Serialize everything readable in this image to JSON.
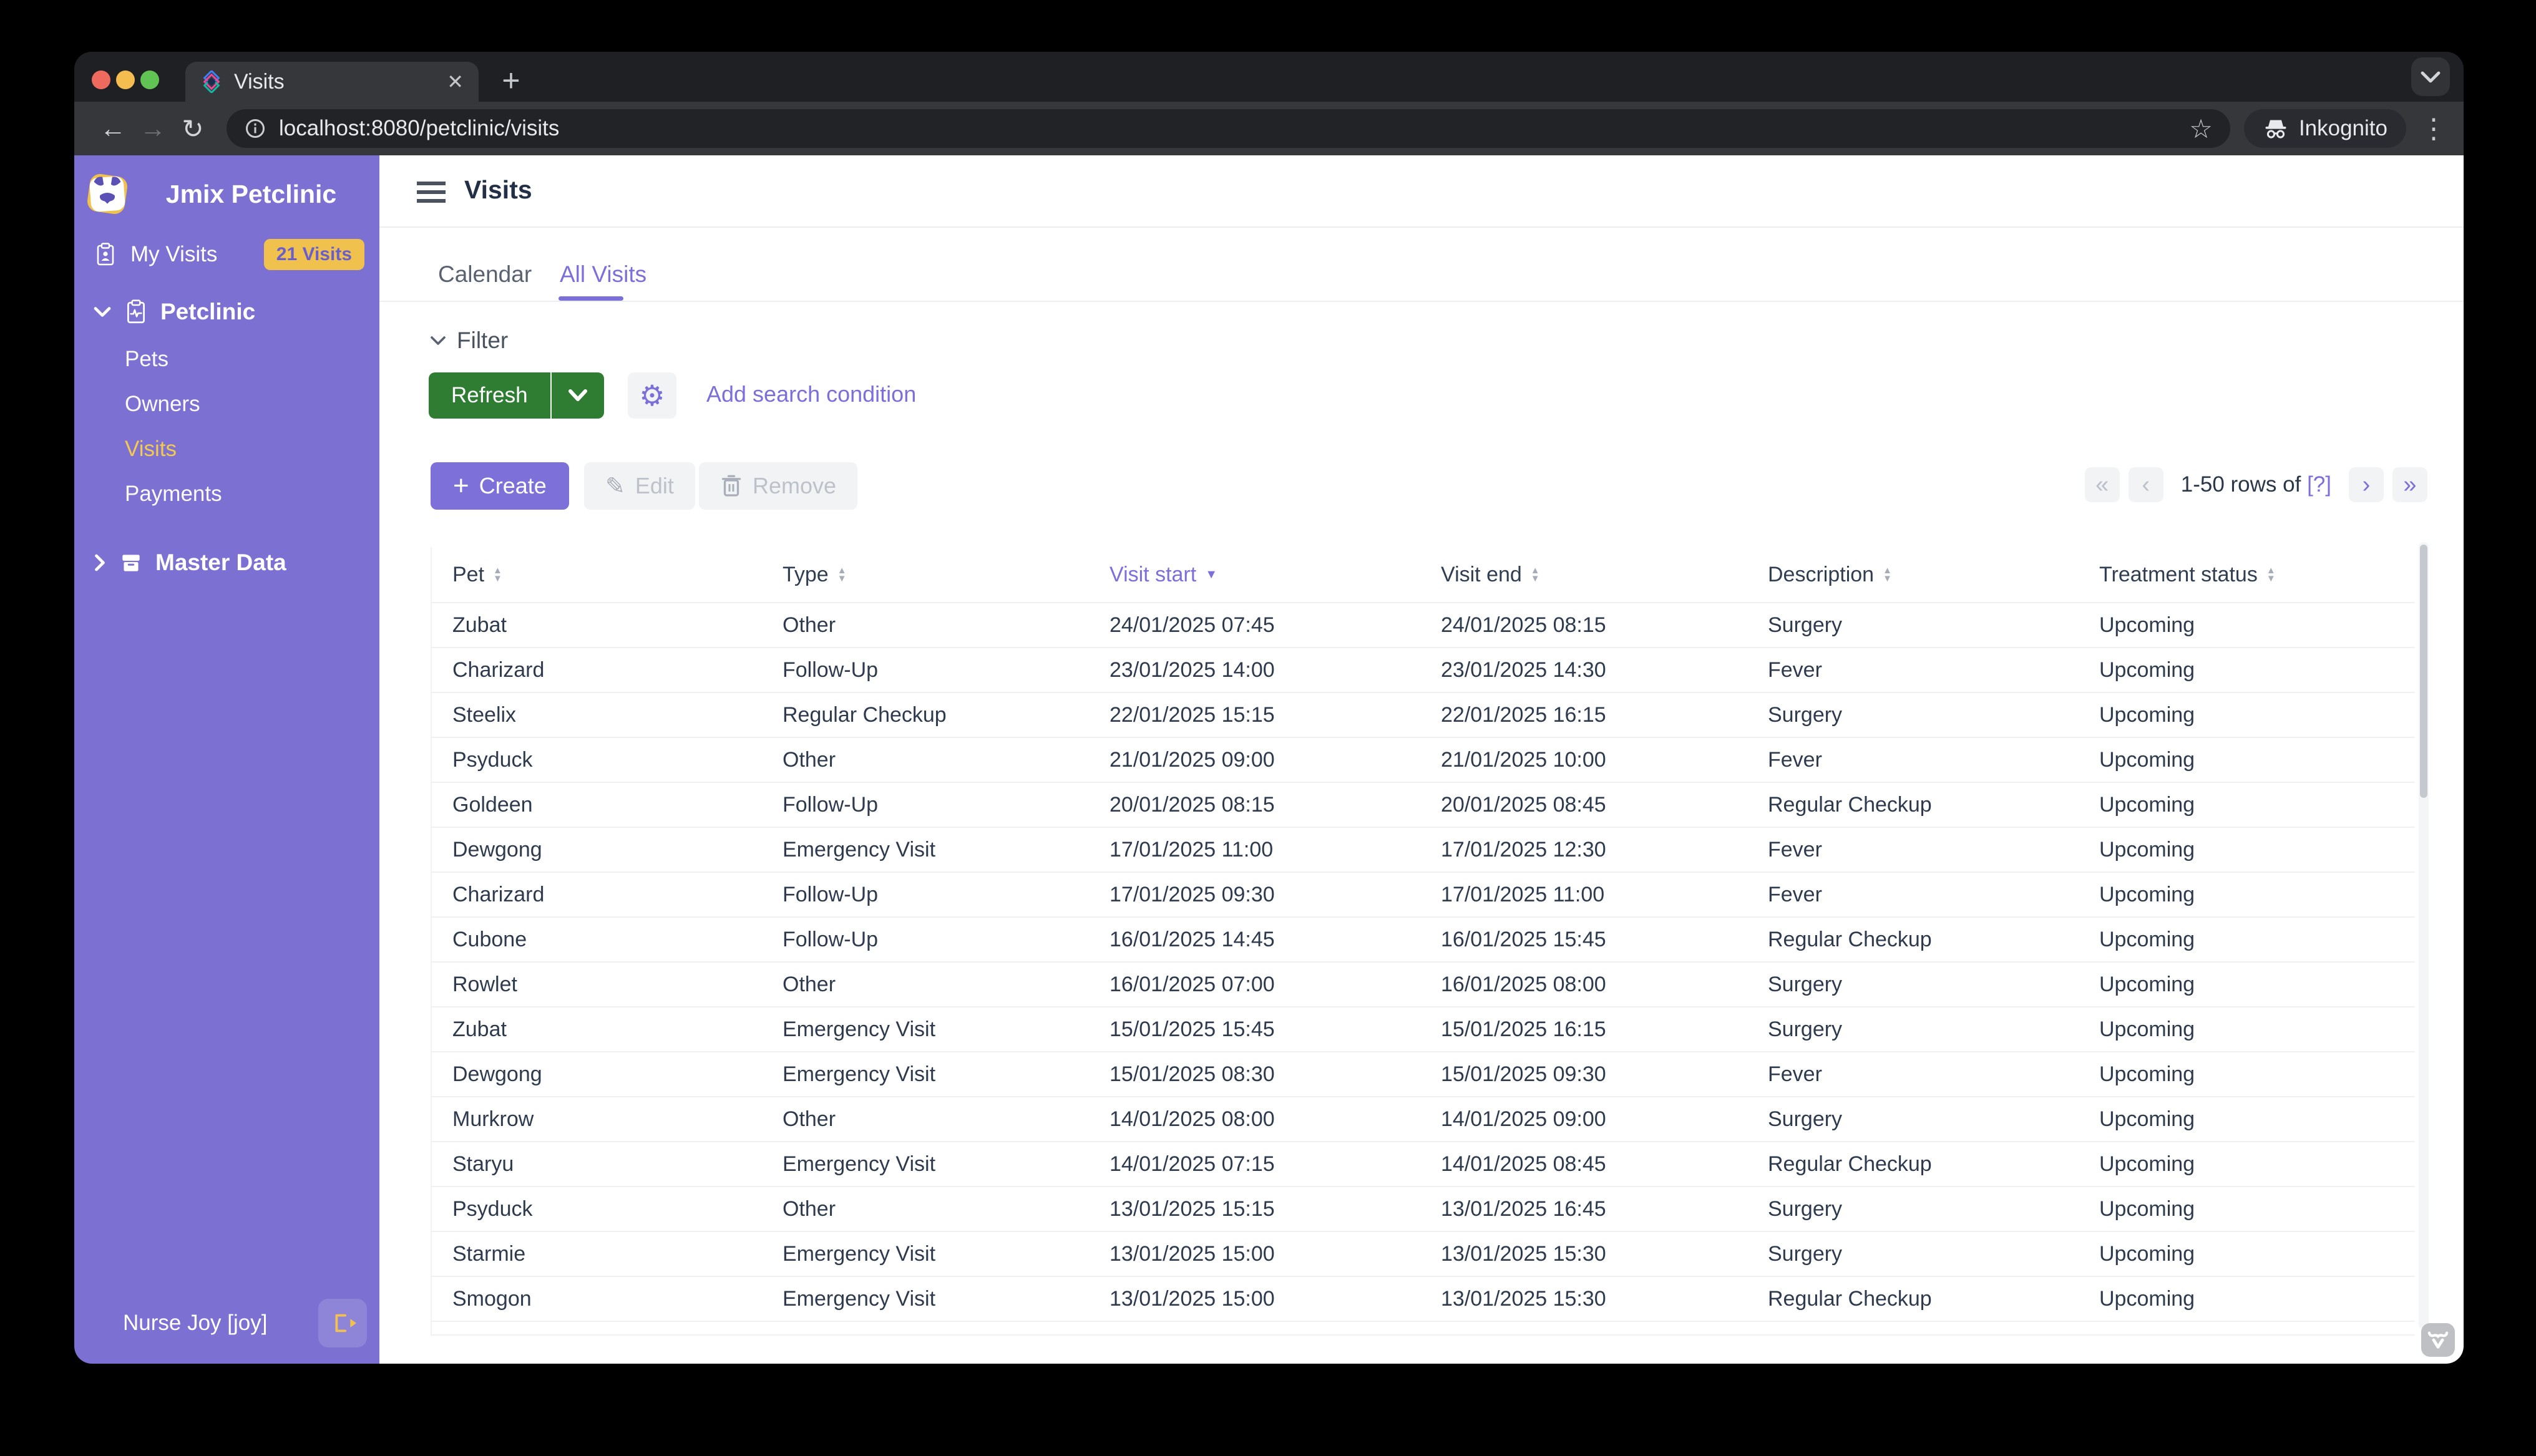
{
  "browser": {
    "tab_title": "Visits",
    "url": "localhost:8080/petclinic/visits",
    "incognito_label": "Inkognito",
    "glyphs": {
      "back": "←",
      "forward": "→",
      "reload": "↻",
      "star": "☆",
      "menu_dots": "⋮",
      "new_tab": "+",
      "tab_close": "✕"
    }
  },
  "sidebar": {
    "app_title": "Jmix Petclinic",
    "my_visits": {
      "label": "My Visits",
      "badge": "21 Visits"
    },
    "groups": [
      {
        "label": "Petclinic",
        "items": [
          "Pets",
          "Owners",
          "Visits",
          "Payments"
        ],
        "active_item": "Visits"
      },
      {
        "label": "Master Data",
        "items": []
      }
    ],
    "user": "Nurse Joy [joy]"
  },
  "main": {
    "title": "Visits",
    "tabs": {
      "calendar": "Calendar",
      "all_visits": "All Visits",
      "selected": "All Visits"
    }
  },
  "filter": {
    "section_label": "Filter",
    "refresh_label": "Refresh",
    "add_condition_label": "Add search condition",
    "gear_icon": "⚙"
  },
  "actions": {
    "create": "Create",
    "edit": "Edit",
    "remove": "Remove",
    "plus": "+",
    "pencil": "✎"
  },
  "pagination": {
    "first": "«",
    "prev": "‹",
    "next": "›",
    "last": "»",
    "range_text": "1-50 rows of",
    "total_placeholder": "[?]"
  },
  "icons": {
    "sort_asc": "▲",
    "sort_desc": "▼"
  },
  "table": {
    "columns": [
      "Pet",
      "Type",
      "Visit start",
      "Visit end",
      "Description",
      "Treatment status"
    ],
    "sorted_column": "Visit start",
    "sort_direction": "desc",
    "rows": [
      {
        "pet": "Zubat",
        "type": "Other",
        "start": "24/01/2025 07:45",
        "end": "24/01/2025 08:15",
        "description": "Surgery",
        "status": "Upcoming"
      },
      {
        "pet": "Charizard",
        "type": "Follow-Up",
        "start": "23/01/2025 14:00",
        "end": "23/01/2025 14:30",
        "description": "Fever",
        "status": "Upcoming"
      },
      {
        "pet": "Steelix",
        "type": "Regular Checkup",
        "start": "22/01/2025 15:15",
        "end": "22/01/2025 16:15",
        "description": "Surgery",
        "status": "Upcoming"
      },
      {
        "pet": "Psyduck",
        "type": "Other",
        "start": "21/01/2025 09:00",
        "end": "21/01/2025 10:00",
        "description": "Fever",
        "status": "Upcoming"
      },
      {
        "pet": "Goldeen",
        "type": "Follow-Up",
        "start": "20/01/2025 08:15",
        "end": "20/01/2025 08:45",
        "description": "Regular Checkup",
        "status": "Upcoming"
      },
      {
        "pet": "Dewgong",
        "type": "Emergency Visit",
        "start": "17/01/2025 11:00",
        "end": "17/01/2025 12:30",
        "description": "Fever",
        "status": "Upcoming"
      },
      {
        "pet": "Charizard",
        "type": "Follow-Up",
        "start": "17/01/2025 09:30",
        "end": "17/01/2025 11:00",
        "description": "Fever",
        "status": "Upcoming"
      },
      {
        "pet": "Cubone",
        "type": "Follow-Up",
        "start": "16/01/2025 14:45",
        "end": "16/01/2025 15:45",
        "description": "Regular Checkup",
        "status": "Upcoming"
      },
      {
        "pet": "Rowlet",
        "type": "Other",
        "start": "16/01/2025 07:00",
        "end": "16/01/2025 08:00",
        "description": "Surgery",
        "status": "Upcoming"
      },
      {
        "pet": "Zubat",
        "type": "Emergency Visit",
        "start": "15/01/2025 15:45",
        "end": "15/01/2025 16:15",
        "description": "Surgery",
        "status": "Upcoming"
      },
      {
        "pet": "Dewgong",
        "type": "Emergency Visit",
        "start": "15/01/2025 08:30",
        "end": "15/01/2025 09:30",
        "description": "Fever",
        "status": "Upcoming"
      },
      {
        "pet": "Murkrow",
        "type": "Other",
        "start": "14/01/2025 08:00",
        "end": "14/01/2025 09:00",
        "description": "Surgery",
        "status": "Upcoming"
      },
      {
        "pet": "Staryu",
        "type": "Emergency Visit",
        "start": "14/01/2025 07:15",
        "end": "14/01/2025 08:45",
        "description": "Regular Checkup",
        "status": "Upcoming"
      },
      {
        "pet": "Psyduck",
        "type": "Other",
        "start": "13/01/2025 15:15",
        "end": "13/01/2025 16:45",
        "description": "Surgery",
        "status": "Upcoming"
      },
      {
        "pet": "Starmie",
        "type": "Emergency Visit",
        "start": "13/01/2025 15:00",
        "end": "13/01/2025 15:30",
        "description": "Surgery",
        "status": "Upcoming"
      },
      {
        "pet": "Smogon",
        "type": "Emergency Visit",
        "start": "13/01/2025 15:00",
        "end": "13/01/2025 15:30",
        "description": "Regular Checkup",
        "status": "Upcoming"
      }
    ]
  },
  "colors": {
    "sidebar_purple": "#7C70D2",
    "accent_purple": "#7C6FD9",
    "refresh_green": "#2E7D32",
    "badge_yellow": "#F0C14D",
    "active_item_yellow": "#F3C94F",
    "table_text": "#2E3B4E",
    "chrome_dark": "#1F2023",
    "toolbar_dark": "#36373B"
  }
}
